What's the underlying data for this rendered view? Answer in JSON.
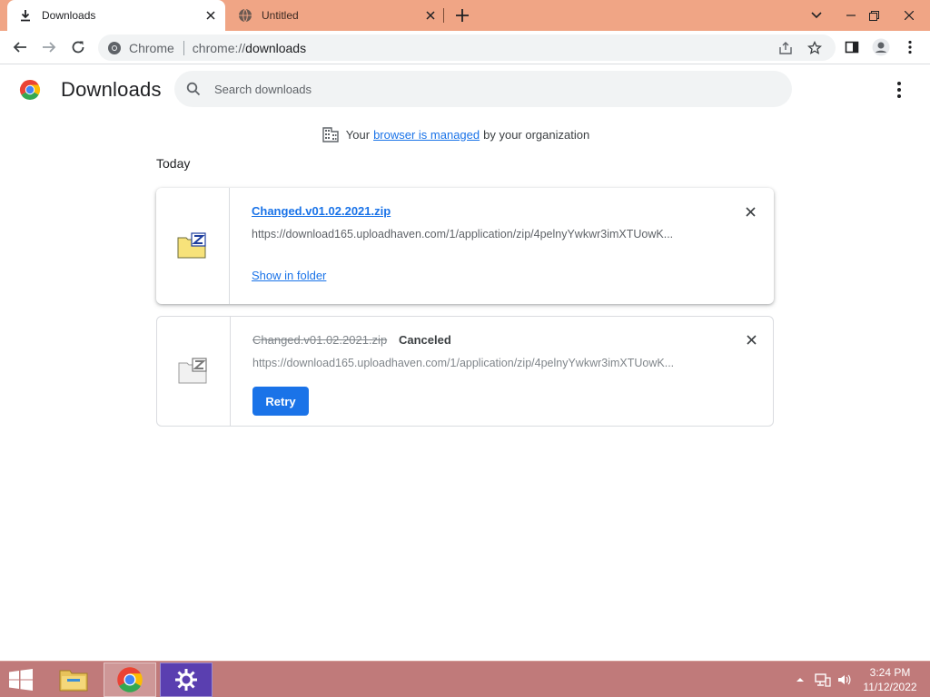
{
  "browser": {
    "tabs": [
      {
        "title": "Downloads",
        "active": true,
        "icon": "download-icon"
      },
      {
        "title": "Untitled",
        "active": false,
        "icon": "globe-icon"
      }
    ],
    "omnibox": {
      "site_chip": "Chrome",
      "url_scheme": "chrome://",
      "url_host": "downloads"
    }
  },
  "page": {
    "title": "Downloads",
    "search_placeholder": "Search downloads",
    "managed_notice": {
      "prefix": "Your",
      "link": "browser is managed",
      "suffix": "by your organization"
    },
    "date_group": "Today",
    "downloads": [
      {
        "file_name": "Changed.v01.02.2021.zip",
        "url": "https://download165.uploadhaven.com/1/application/zip/4pelnyYwkwr3imXTUowK...",
        "action_link": "Show in folder",
        "status": "complete",
        "icon": "zip-file-icon"
      },
      {
        "file_name": "Changed.v01.02.2021.zip",
        "status_label": "Canceled",
        "url": "https://download165.uploadhaven.com/1/application/zip/4pelnyYwkwr3imXTUowK...",
        "action_button": "Retry",
        "status": "canceled",
        "icon": "zip-file-icon"
      }
    ]
  },
  "taskbar": {
    "apps": [
      "file-explorer-icon",
      "chrome-icon",
      "settings-icon"
    ],
    "active_app": "chrome-icon",
    "clock_time": "3:24 PM",
    "clock_date": "11/12/2022"
  },
  "colors": {
    "tabstrip": "#f0a585",
    "taskbar": "#c07a7a",
    "link": "#1a73e8",
    "retry_button": "#1a73e8"
  }
}
